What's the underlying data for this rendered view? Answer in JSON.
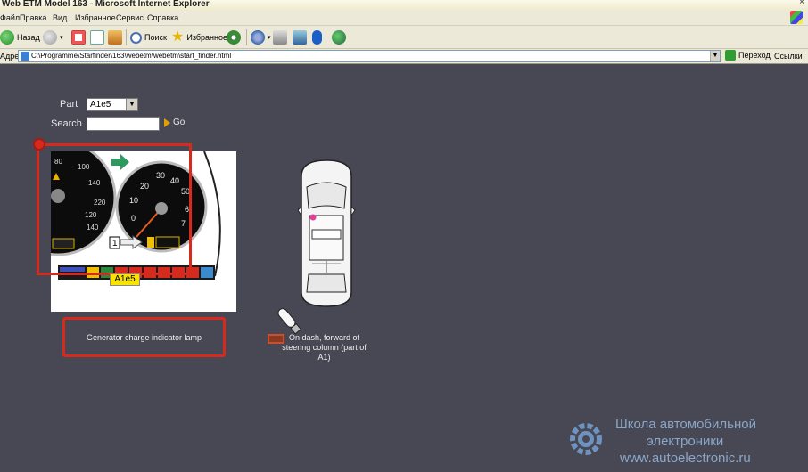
{
  "window": {
    "title": "Web ETM Model 163 - Microsoft Internet Explorer"
  },
  "menu": {
    "items": [
      "Файл",
      "Правка",
      "Вид",
      "Избранное",
      "Сервис",
      "Справка"
    ]
  },
  "toolbar": {
    "back_label": "Назад",
    "search_label": "Поиск",
    "favorites_label": "Избранное"
  },
  "address": {
    "label": "Адрес",
    "url": "C:\\Programme\\Starfinder\\163\\webetm\\webetm\\start_finder.html",
    "go_label": "Переход",
    "links_label": "Ссылки"
  },
  "finder": {
    "part_label": "Part",
    "part_value": "A1e5",
    "search_label": "Search",
    "search_value": "",
    "go_label": "Go"
  },
  "component": {
    "tag": "A1e5",
    "description": "Generator charge indicator lamp",
    "location": "On dash, forward of steering column (part of A1)"
  },
  "watermark": {
    "line1": "Школа автомобильной",
    "line2": "электроники",
    "line3": "www.autoelectronic.ru"
  },
  "colors": {
    "page_bg": "#484854",
    "highlight": "#d62a1e",
    "tag_bg": "#f7e400"
  },
  "icons": [
    "back-icon",
    "forward-icon",
    "stop-icon",
    "refresh-icon",
    "home-icon",
    "search-icon",
    "favorites-icon",
    "media-icon",
    "mail-icon",
    "print-icon",
    "edit-icon",
    "bluetooth-icon",
    "messenger-icon"
  ]
}
